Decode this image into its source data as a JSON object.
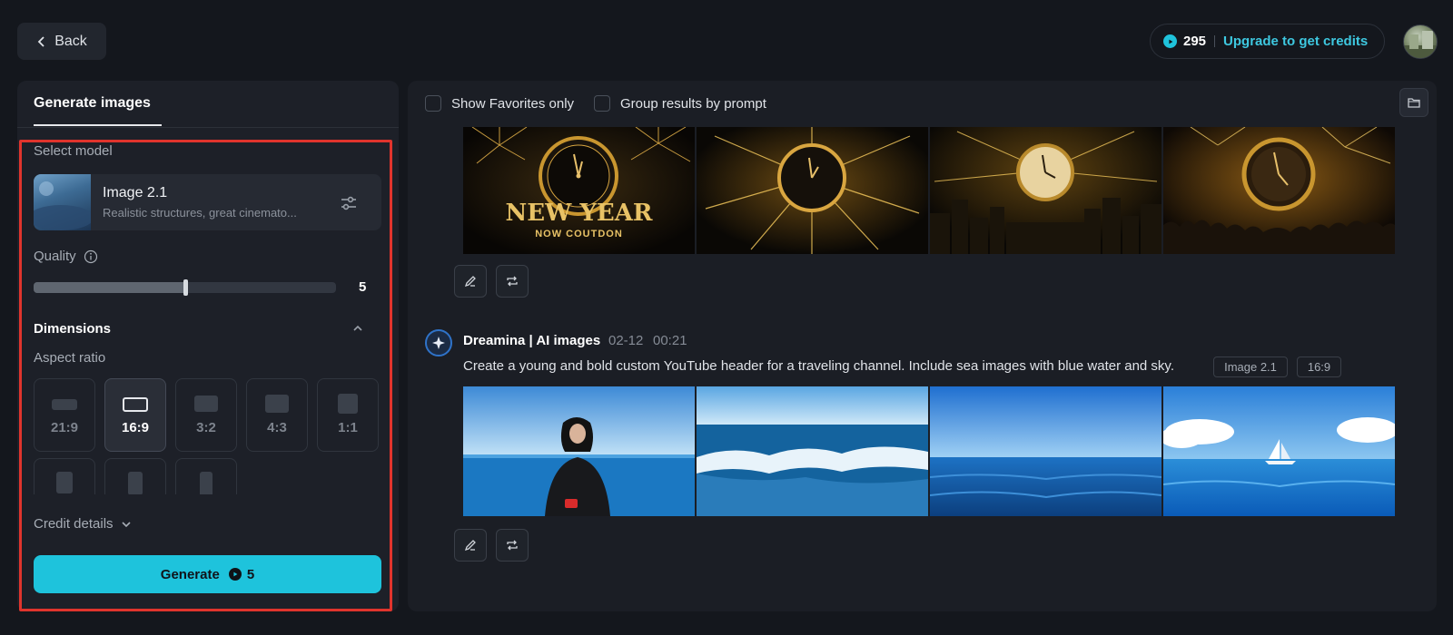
{
  "header": {
    "back_label": "Back",
    "credits_count": "295",
    "upgrade_label": "Upgrade to get credits"
  },
  "left_panel": {
    "tab_label": "Generate images",
    "select_model_label": "Select model",
    "model": {
      "name": "Image 2.1",
      "description": "Realistic structures, great cinemato..."
    },
    "quality_label": "Quality",
    "quality_value": "5",
    "quality_fraction": 0.5,
    "dimensions_label": "Dimensions",
    "aspect_ratio_label": "Aspect ratio",
    "aspect_ratios": [
      "21:9",
      "16:9",
      "3:2",
      "4:3",
      "1:1"
    ],
    "selected_ratio": "16:9",
    "credit_details_label": "Credit details",
    "generate_label": "Generate",
    "generate_cost": "5"
  },
  "results": {
    "show_favorites_label": "Show Favorites only",
    "group_by_prompt_label": "Group results by prompt",
    "first_group": {
      "tile_title": "NEW YEAR",
      "tile_subtitle": "NOW COUTDON"
    },
    "second_group": {
      "author": "Dreamina | AI images",
      "date": "02-12",
      "time": "00:21",
      "prompt": "Create a young and bold custom YouTube header for a traveling channel. Include sea images with blue water and sky.",
      "tags": [
        "Image 2.1",
        "16:9"
      ]
    }
  }
}
